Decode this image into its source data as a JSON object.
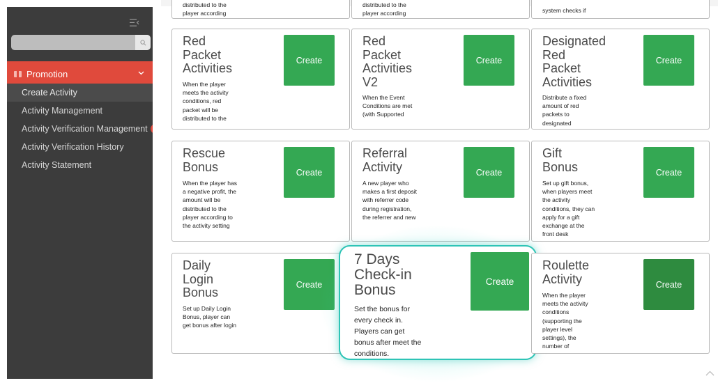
{
  "sidebar": {
    "collapse_icon": "menu-collapse-icon",
    "search": {
      "value": "",
      "placeholder": ""
    },
    "section": {
      "label": "Promotion",
      "icon": "gift-icon",
      "color": "#e04a3c"
    },
    "items": [
      {
        "label": "Create Activity",
        "active": true
      },
      {
        "label": "Activity Management"
      },
      {
        "label": "Activity Verification Management",
        "badge": "21"
      },
      {
        "label": "Activity Verification History"
      },
      {
        "label": "Activity Statement"
      }
    ]
  },
  "top_partial_cards": [
    {
      "text": "distributed to the\nplayer according"
    },
    {
      "text": "distributed to the\nplayer according"
    },
    {
      "text": "system checks if"
    }
  ],
  "create_label": "Create",
  "accent_green": "#34a853",
  "highlight_color": "#2ec4b6",
  "cards": [
    {
      "title": "Red\nPacket\nActivities",
      "desc": "When the player meets the activity conditions, red packet will be distributed to the"
    },
    {
      "title": "Red\nPacket\nActivities\nV2",
      "desc": "When the Event Conditions are met (with Supported"
    },
    {
      "title": "Designated\nRed\nPacket\nActivities",
      "desc": "Distribute a fixed amount of red packets to designated"
    },
    {
      "title": "Rescue\nBonus",
      "desc": "When the player has a negative profit, the amount will be distributed to the player according to the activity setting"
    },
    {
      "title": "Referral\nActivity",
      "desc": "A new player who makes a first deposit with referrer code during registration, the referrer and new"
    },
    {
      "title": "Gift\nBonus",
      "desc": "Set up gift bonus, when players meet the activity conditions, they can apply for a gift exchange at the front desk"
    },
    {
      "title": "Daily\nLogin\nBonus",
      "desc": "Set up Daily Login Bonus, player can get bonus after login"
    },
    {
      "title": "7 Days\nCheck-in\nBonus",
      "desc": "Set the bonus for every check in. Players can get bonus after meet the conditions."
    },
    {
      "title": "Roulette\nActivity",
      "desc": "When the player meets the activity conditions (supporting the player level settings), the number of"
    }
  ]
}
